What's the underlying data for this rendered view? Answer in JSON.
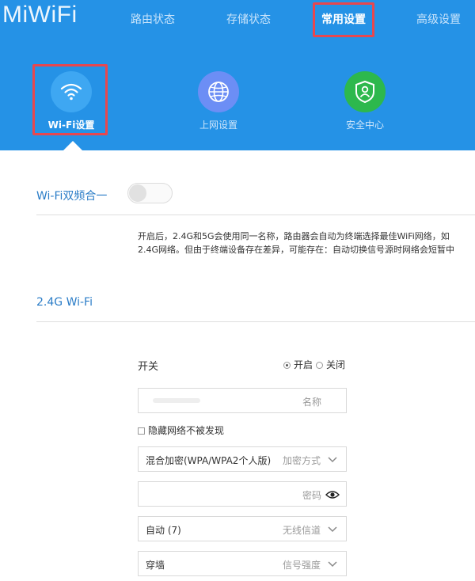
{
  "logo": "MiWiFi",
  "nav": {
    "items": [
      {
        "label": "路由状态"
      },
      {
        "label": "存储状态"
      },
      {
        "label": "常用设置",
        "active": true
      },
      {
        "label": "高级设置"
      }
    ]
  },
  "subnav": {
    "items": [
      {
        "label": "Wi-Fi设置",
        "icon": "wifi-icon",
        "color": "#3ea7f2",
        "active": true
      },
      {
        "label": "上网设置",
        "icon": "globe-icon",
        "color": "#6c8ef5"
      },
      {
        "label": "安全中心",
        "icon": "shield-user-icon",
        "color": "#2db84d"
      }
    ]
  },
  "dual_band": {
    "label": "Wi-Fi双频合一",
    "enabled": false,
    "desc_line1": "开启后，2.4G和5G会使用同一名称，路由器会自动为终端选择最佳WiFi网络，如",
    "desc_line2": "2.4G网络。但由于终端设备存在差异，可能存在：自动切换信号源时网络会短暂中"
  },
  "section_24g": {
    "title": "2.4G Wi-Fi",
    "switch_label": "开关",
    "radio_on_label": "开启",
    "radio_off_label": "关闭",
    "radio_selected": "on",
    "name_placeholder": "名称",
    "hide_network_label": "隐藏网络不被发现",
    "encryption_value": "混合加密(WPA/WPA2个人版)",
    "encryption_placeholder": "加密方式",
    "password_placeholder": "密码",
    "channel_value": "自动 (7)",
    "channel_placeholder": "无线信道",
    "signal_value": "穿墙",
    "signal_placeholder": "信号强度"
  },
  "colors": {
    "header_bg": "#2592e6",
    "highlight_box": "#e8474f",
    "section_title": "#2a7cc7"
  }
}
